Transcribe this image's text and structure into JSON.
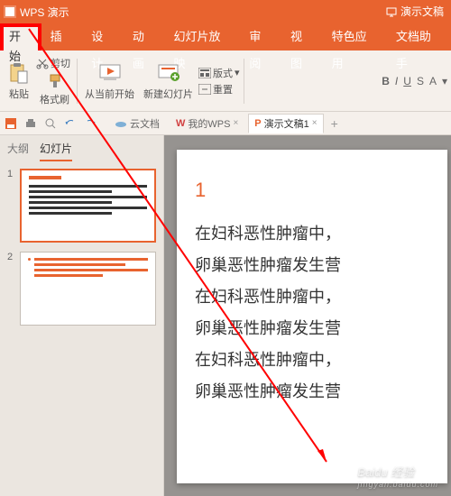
{
  "titlebar": {
    "app": "WPS 演示",
    "rightBtn": "演示文稿"
  },
  "menu": {
    "items": [
      "开始",
      "插入",
      "设计",
      "动画",
      "幻灯片放映",
      "审阅",
      "视图",
      "特色应用",
      "文档助手"
    ],
    "activeIndex": 0
  },
  "ribbon": {
    "paste": "粘贴",
    "cut": "剪切",
    "formatBrush": "格式刷",
    "fromCurrent": "从当前开始",
    "newSlide": "新建幻灯片",
    "layout": "版式",
    "resetGroup": "重置"
  },
  "toolbarRight": {
    "b": "B",
    "i": "I",
    "u": "U",
    "s": "S",
    "a": "A"
  },
  "docTabs": {
    "cloud": "云文档",
    "myWps": "我的WPS",
    "activeDoc": "演示文稿1"
  },
  "side": {
    "outline": "大纲",
    "slides": "幻灯片",
    "activeIndex": 1
  },
  "thumbnails": [
    {
      "num": "1"
    },
    {
      "num": "2"
    }
  ],
  "page": {
    "number": "1",
    "lines": [
      "在妇科恶性肿瘤中，",
      "卵巢恶性肿瘤发生营",
      "在妇科恶性肿瘤中，",
      "卵巢恶性肿瘤发生营",
      "在妇科恶性肿瘤中，",
      "卵巢恶性肿瘤发生营"
    ]
  },
  "watermark": {
    "brand": "Baidu 经验",
    "url": "jingyan.baidu.com"
  }
}
